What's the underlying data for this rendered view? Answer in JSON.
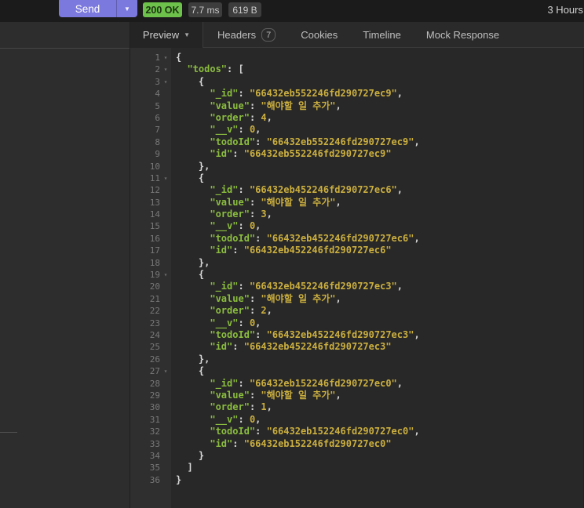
{
  "topbar": {
    "send_label": "Send",
    "status": "200 OK",
    "time": "7.7 ms",
    "size": "619 B",
    "history": "3 Hours"
  },
  "tabs": {
    "preview": "Preview",
    "headers": "Headers",
    "headers_count": "7",
    "cookies": "Cookies",
    "timeline": "Timeline",
    "mock": "Mock Response"
  },
  "colors": {
    "accent": "#7b79dd",
    "status-green": "#6cc24a",
    "token-key": "#8bbd3f",
    "token-str": "#cbaf3f",
    "token-num": "#cbaf3f",
    "token-punc": "#d9d9d9"
  },
  "code": {
    "fold_glyph": "▾",
    "lines": [
      {
        "n": 1,
        "f": 1,
        "t": [
          [
            "p",
            "{"
          ]
        ]
      },
      {
        "n": 2,
        "f": 1,
        "t": [
          [
            "p",
            "  "
          ],
          [
            "k",
            "\"todos\""
          ],
          [
            "p",
            ": ["
          ]
        ]
      },
      {
        "n": 3,
        "f": 1,
        "t": [
          [
            "p",
            "    {"
          ]
        ]
      },
      {
        "n": 4,
        "t": [
          [
            "p",
            "      "
          ],
          [
            "k",
            "\"_id\""
          ],
          [
            "p",
            ": "
          ],
          [
            "s",
            "\"66432eb552246fd290727ec9\""
          ],
          [
            "p",
            ","
          ]
        ]
      },
      {
        "n": 5,
        "t": [
          [
            "p",
            "      "
          ],
          [
            "k",
            "\"value\""
          ],
          [
            "p",
            ": "
          ],
          [
            "s",
            "\"해야할 일 추가\""
          ],
          [
            "p",
            ","
          ]
        ]
      },
      {
        "n": 6,
        "t": [
          [
            "p",
            "      "
          ],
          [
            "k",
            "\"order\""
          ],
          [
            "p",
            ": "
          ],
          [
            "n",
            "4"
          ],
          [
            "p",
            ","
          ]
        ]
      },
      {
        "n": 7,
        "t": [
          [
            "p",
            "      "
          ],
          [
            "k",
            "\"__v\""
          ],
          [
            "p",
            ": "
          ],
          [
            "n",
            "0"
          ],
          [
            "p",
            ","
          ]
        ]
      },
      {
        "n": 8,
        "t": [
          [
            "p",
            "      "
          ],
          [
            "k",
            "\"todoId\""
          ],
          [
            "p",
            ": "
          ],
          [
            "s",
            "\"66432eb552246fd290727ec9\""
          ],
          [
            "p",
            ","
          ]
        ]
      },
      {
        "n": 9,
        "t": [
          [
            "p",
            "      "
          ],
          [
            "k",
            "\"id\""
          ],
          [
            "p",
            ": "
          ],
          [
            "s",
            "\"66432eb552246fd290727ec9\""
          ]
        ]
      },
      {
        "n": 10,
        "t": [
          [
            "p",
            "    },"
          ]
        ]
      },
      {
        "n": 11,
        "f": 1,
        "t": [
          [
            "p",
            "    {"
          ]
        ]
      },
      {
        "n": 12,
        "t": [
          [
            "p",
            "      "
          ],
          [
            "k",
            "\"_id\""
          ],
          [
            "p",
            ": "
          ],
          [
            "s",
            "\"66432eb452246fd290727ec6\""
          ],
          [
            "p",
            ","
          ]
        ]
      },
      {
        "n": 13,
        "t": [
          [
            "p",
            "      "
          ],
          [
            "k",
            "\"value\""
          ],
          [
            "p",
            ": "
          ],
          [
            "s",
            "\"해야할 일 추가\""
          ],
          [
            "p",
            ","
          ]
        ]
      },
      {
        "n": 14,
        "t": [
          [
            "p",
            "      "
          ],
          [
            "k",
            "\"order\""
          ],
          [
            "p",
            ": "
          ],
          [
            "n",
            "3"
          ],
          [
            "p",
            ","
          ]
        ]
      },
      {
        "n": 15,
        "t": [
          [
            "p",
            "      "
          ],
          [
            "k",
            "\"__v\""
          ],
          [
            "p",
            ": "
          ],
          [
            "n",
            "0"
          ],
          [
            "p",
            ","
          ]
        ]
      },
      {
        "n": 16,
        "t": [
          [
            "p",
            "      "
          ],
          [
            "k",
            "\"todoId\""
          ],
          [
            "p",
            ": "
          ],
          [
            "s",
            "\"66432eb452246fd290727ec6\""
          ],
          [
            "p",
            ","
          ]
        ]
      },
      {
        "n": 17,
        "t": [
          [
            "p",
            "      "
          ],
          [
            "k",
            "\"id\""
          ],
          [
            "p",
            ": "
          ],
          [
            "s",
            "\"66432eb452246fd290727ec6\""
          ]
        ]
      },
      {
        "n": 18,
        "t": [
          [
            "p",
            "    },"
          ]
        ]
      },
      {
        "n": 19,
        "f": 1,
        "t": [
          [
            "p",
            "    {"
          ]
        ]
      },
      {
        "n": 20,
        "t": [
          [
            "p",
            "      "
          ],
          [
            "k",
            "\"_id\""
          ],
          [
            "p",
            ": "
          ],
          [
            "s",
            "\"66432eb452246fd290727ec3\""
          ],
          [
            "p",
            ","
          ]
        ]
      },
      {
        "n": 21,
        "t": [
          [
            "p",
            "      "
          ],
          [
            "k",
            "\"value\""
          ],
          [
            "p",
            ": "
          ],
          [
            "s",
            "\"해야할 일 추가\""
          ],
          [
            "p",
            ","
          ]
        ]
      },
      {
        "n": 22,
        "t": [
          [
            "p",
            "      "
          ],
          [
            "k",
            "\"order\""
          ],
          [
            "p",
            ": "
          ],
          [
            "n",
            "2"
          ],
          [
            "p",
            ","
          ]
        ]
      },
      {
        "n": 23,
        "t": [
          [
            "p",
            "      "
          ],
          [
            "k",
            "\"__v\""
          ],
          [
            "p",
            ": "
          ],
          [
            "n",
            "0"
          ],
          [
            "p",
            ","
          ]
        ]
      },
      {
        "n": 24,
        "t": [
          [
            "p",
            "      "
          ],
          [
            "k",
            "\"todoId\""
          ],
          [
            "p",
            ": "
          ],
          [
            "s",
            "\"66432eb452246fd290727ec3\""
          ],
          [
            "p",
            ","
          ]
        ]
      },
      {
        "n": 25,
        "t": [
          [
            "p",
            "      "
          ],
          [
            "k",
            "\"id\""
          ],
          [
            "p",
            ": "
          ],
          [
            "s",
            "\"66432eb452246fd290727ec3\""
          ]
        ]
      },
      {
        "n": 26,
        "t": [
          [
            "p",
            "    },"
          ]
        ]
      },
      {
        "n": 27,
        "f": 1,
        "t": [
          [
            "p",
            "    {"
          ]
        ]
      },
      {
        "n": 28,
        "t": [
          [
            "p",
            "      "
          ],
          [
            "k",
            "\"_id\""
          ],
          [
            "p",
            ": "
          ],
          [
            "s",
            "\"66432eb152246fd290727ec0\""
          ],
          [
            "p",
            ","
          ]
        ]
      },
      {
        "n": 29,
        "t": [
          [
            "p",
            "      "
          ],
          [
            "k",
            "\"value\""
          ],
          [
            "p",
            ": "
          ],
          [
            "s",
            "\"해야할 일 추가\""
          ],
          [
            "p",
            ","
          ]
        ]
      },
      {
        "n": 30,
        "t": [
          [
            "p",
            "      "
          ],
          [
            "k",
            "\"order\""
          ],
          [
            "p",
            ": "
          ],
          [
            "n",
            "1"
          ],
          [
            "p",
            ","
          ]
        ]
      },
      {
        "n": 31,
        "t": [
          [
            "p",
            "      "
          ],
          [
            "k",
            "\"__v\""
          ],
          [
            "p",
            ": "
          ],
          [
            "n",
            "0"
          ],
          [
            "p",
            ","
          ]
        ]
      },
      {
        "n": 32,
        "t": [
          [
            "p",
            "      "
          ],
          [
            "k",
            "\"todoId\""
          ],
          [
            "p",
            ": "
          ],
          [
            "s",
            "\"66432eb152246fd290727ec0\""
          ],
          [
            "p",
            ","
          ]
        ]
      },
      {
        "n": 33,
        "t": [
          [
            "p",
            "      "
          ],
          [
            "k",
            "\"id\""
          ],
          [
            "p",
            ": "
          ],
          [
            "s",
            "\"66432eb152246fd290727ec0\""
          ]
        ]
      },
      {
        "n": 34,
        "t": [
          [
            "p",
            "    }"
          ]
        ]
      },
      {
        "n": 35,
        "t": [
          [
            "p",
            "  ]"
          ]
        ]
      },
      {
        "n": 36,
        "t": [
          [
            "p",
            "}"
          ]
        ]
      }
    ]
  }
}
